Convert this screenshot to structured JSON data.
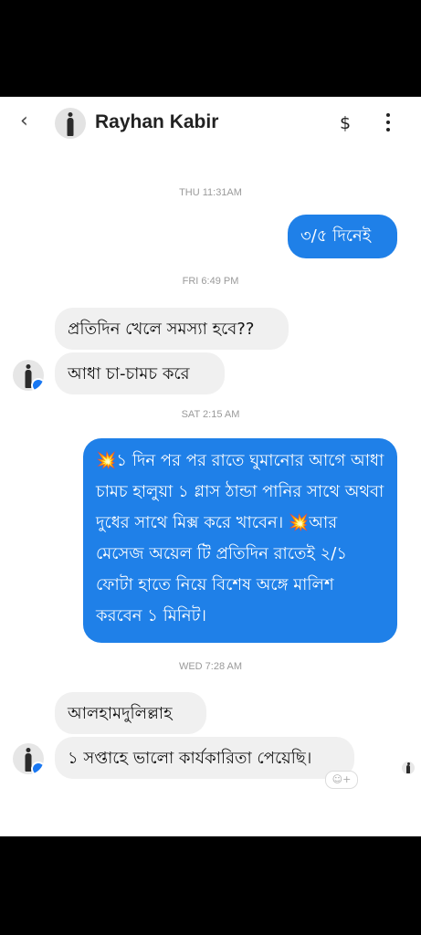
{
  "header": {
    "back_icon": "‹",
    "contact_name": "Rayhan Kabir",
    "payment_icon": "$"
  },
  "messages": {
    "ts1": "THU 11:31AM",
    "m1": "৩/৫ দিনেই",
    "ts2": "FRI 6:49 PM",
    "m2": "প্রতিদিন খেলে সমস্যা হবে??",
    "m3": "আধা চা-চামচ করে",
    "ts3": "SAT 2:15 AM",
    "m4_mark1": "💥",
    "m4_part1": "১ দিন পর পর রাতে ঘুমানোর আগে আধা চামচ হালুয়া ১ গ্লাস ঠান্ডা পানির সাথে অথবা দুধের সাথে মিক্স করে খাবেন।",
    "m4_mark2": "💥",
    "m4_part2": "আর মেসেজ অয়েল টি প্রতিদিন রাতেই ২/১ ফোটা হাতে নিয়ে বিশেষ অঙ্গে মালিশ করবেন ১ মিনিট।",
    "ts4": "WED 7:28 AM",
    "m5": "আলহামদুলিল্লাহ",
    "m6": "১ সপ্তাহে ভালো কার্যকারিতা পেয়েছি।"
  },
  "reaction_placeholder": "☺+",
  "colors": {
    "outgoing": "#1f80e8",
    "incoming": "#f0f0f0",
    "messenger_badge": "#1877f2"
  },
  "icons": [
    "back-icon",
    "dollar-icon",
    "more-vertical-icon",
    "messenger-badge-icon",
    "add-reaction-icon"
  ]
}
